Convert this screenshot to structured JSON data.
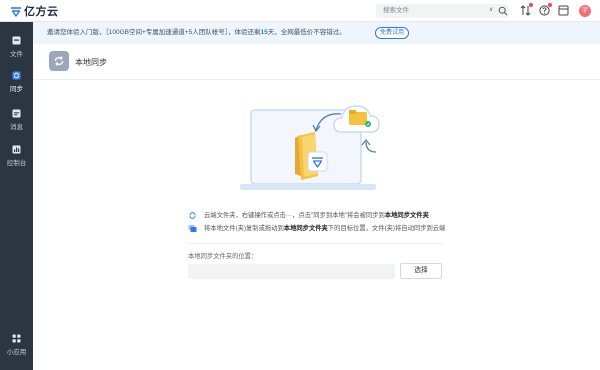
{
  "app": {
    "name": "亿方云"
  },
  "search": {
    "placeholder": "搜索文件",
    "chevron": "∨"
  },
  "user": {
    "avatar_text": "宇"
  },
  "sidebar": {
    "items": [
      {
        "label": "文件",
        "icon": "file-icon"
      },
      {
        "label": "同步",
        "icon": "sync-icon",
        "active": true
      },
      {
        "label": "消息",
        "icon": "message-icon"
      },
      {
        "label": "控制台",
        "icon": "console-icon"
      }
    ],
    "bottom": {
      "label": "小应用",
      "icon": "apps-icon"
    }
  },
  "notice": {
    "prefix": "邀请您体验入门版，［100GB空间+专属加速通道+5人团队帐号］，体验还剩",
    "days": "15",
    "suffix": "天，全网最低价不容错过。",
    "button": "免费试用"
  },
  "header": {
    "title": "本地同步"
  },
  "steps": [
    {
      "icon": "cloud-sync-icon",
      "text_before": "云端文件夹，右键操作或点击",
      "ellipsis": "···",
      "text_middle": "，点击\"同步到本地\"将会被同步到",
      "bold": "本地同步文件夹"
    },
    {
      "icon": "folder-copy-icon",
      "text_before": "将本地文件(夹)复制或拖动到",
      "bold": "本地同步文件夹",
      "text_after": "下的目标位置，文件(夹)将自动同步到云端"
    }
  ],
  "location": {
    "label": "本地同步文件夹的位置：",
    "value": "",
    "button": "选择"
  },
  "colors": {
    "sidebar_bg": "#2c3542",
    "accent": "#2f77f1",
    "notice_bg": "#eef5ff",
    "folder": "#f5c23b"
  }
}
